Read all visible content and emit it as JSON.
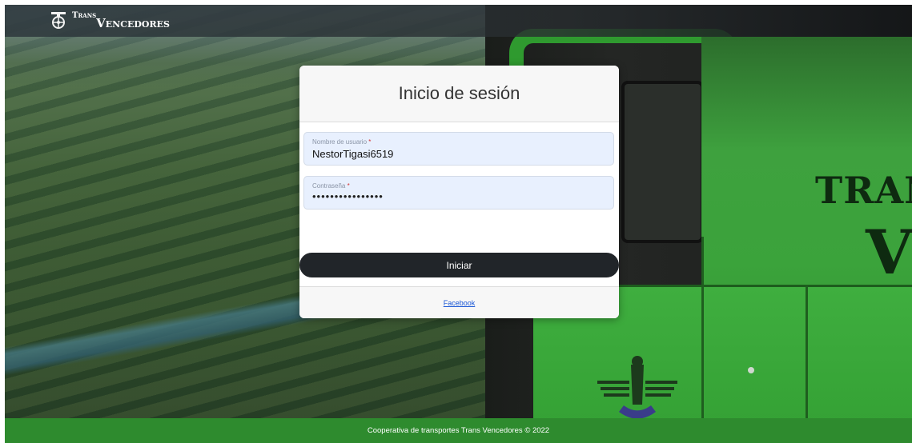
{
  "navbar": {
    "brand_prefix": "Trans",
    "brand_name": "Vencedores"
  },
  "background": {
    "bus_text_line1": "TRANS",
    "bus_text_line2": "V"
  },
  "login": {
    "title": "Inicio de sesión",
    "username_label": "Nombre de usuario",
    "username_value": "NestorTigasi6519",
    "password_label": "Contraseña",
    "password_value": "••••••••••••••••",
    "required_marker": "*",
    "submit_label": "Iniciar",
    "footer_link": "Facebook"
  },
  "footer": {
    "text": "Cooperativa de transportes Trans Vencedores © 2022"
  },
  "colors": {
    "footer_green": "#2e8b2e",
    "button_dark": "#212529",
    "input_fill": "#e8f0fe",
    "link_blue": "#1a57d6"
  }
}
